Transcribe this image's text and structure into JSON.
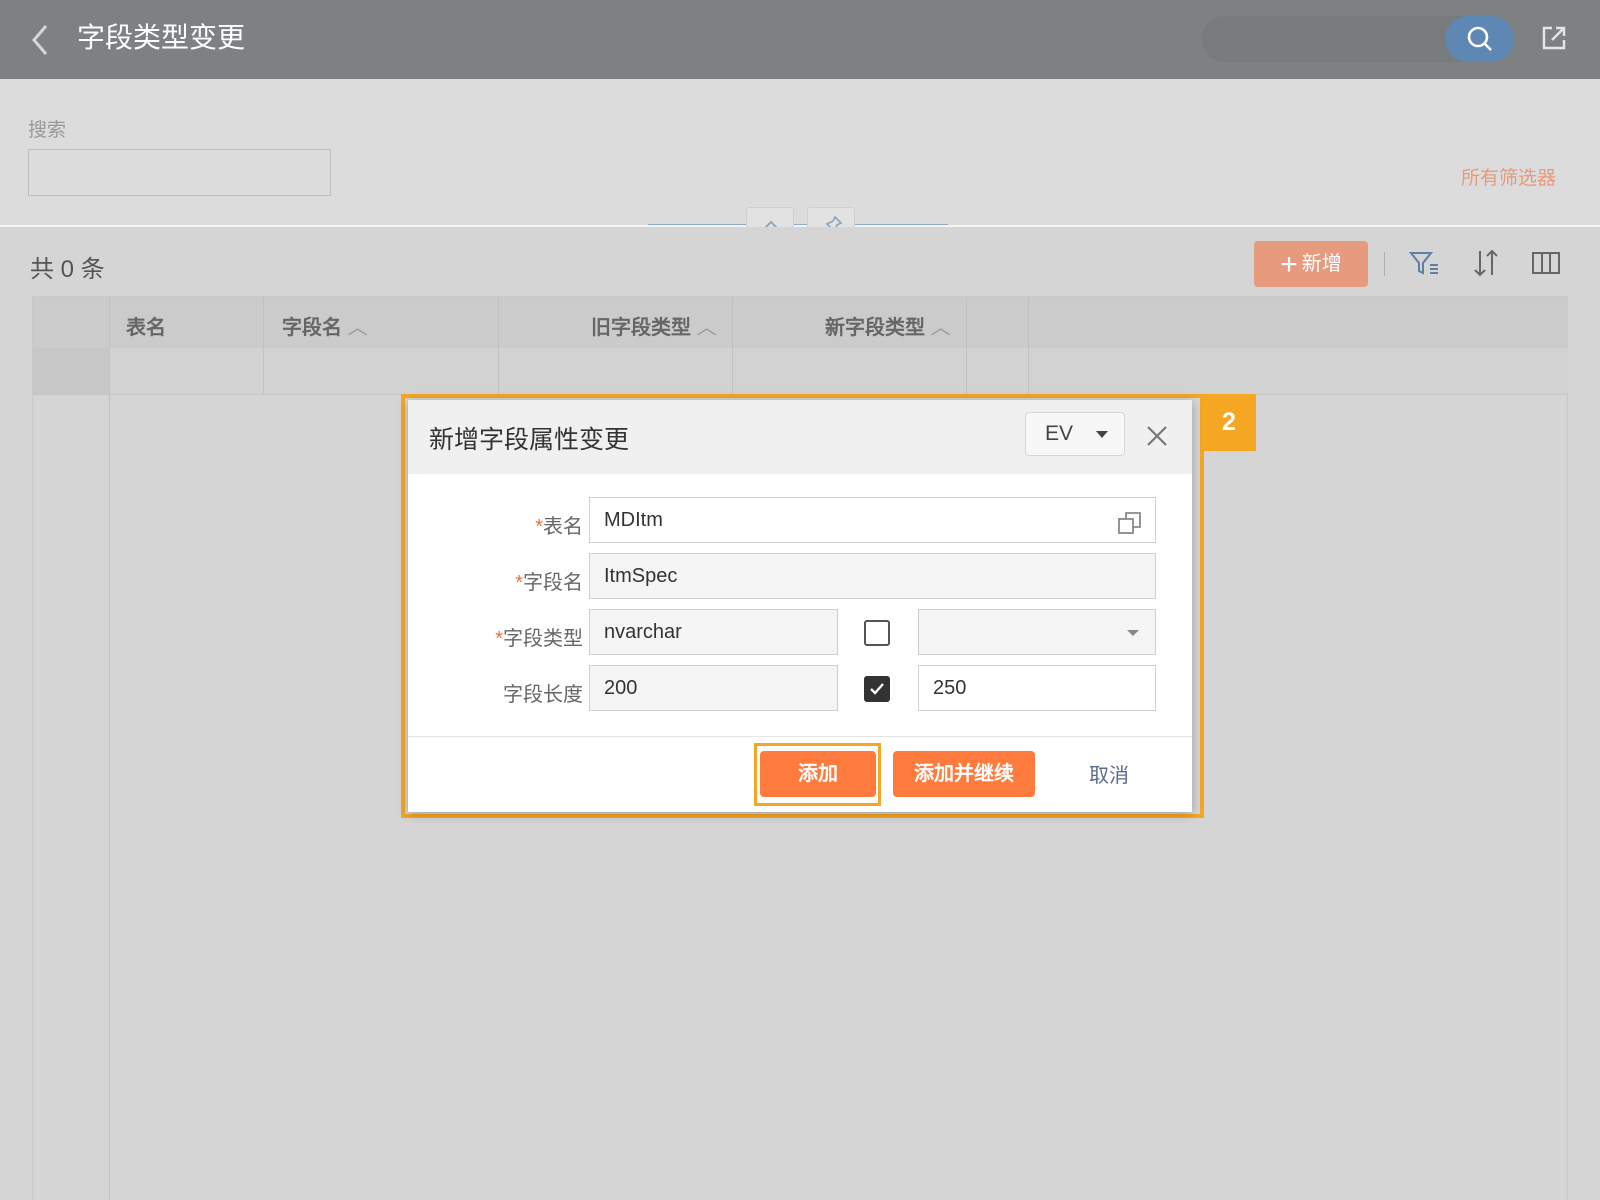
{
  "header": {
    "title": "字段类型变更"
  },
  "filter": {
    "search_label": "搜索",
    "search_value": "",
    "all_filters": "所有筛选器"
  },
  "list": {
    "count_label": "共 0 条",
    "add_label": "新增",
    "columns": [
      "表名",
      "字段名",
      "旧字段类型",
      "新字段类型"
    ]
  },
  "modal": {
    "title": "新增字段属性变更",
    "language": "EV",
    "fields": {
      "table_name": {
        "required": "*",
        "label": "表名",
        "value": "MDItm"
      },
      "field_name": {
        "required": "*",
        "label": "字段名",
        "value": "ItmSpec"
      },
      "field_type": {
        "required": "*",
        "label": "字段类型",
        "value": "nvarchar",
        "checked": false,
        "new_value": ""
      },
      "field_length": {
        "required": "",
        "label": "字段长度",
        "value": "200",
        "checked": true,
        "new_value": "250"
      }
    },
    "buttons": {
      "add": "添加",
      "add_continue": "添加并继续",
      "cancel": "取消"
    }
  },
  "annotation": {
    "step": "2"
  },
  "colors": {
    "header_bg": "#7d8184",
    "accent_orange": "#ff7a3d",
    "highlight_frame": "#f5a623",
    "search_button": "#5e87b3"
  }
}
